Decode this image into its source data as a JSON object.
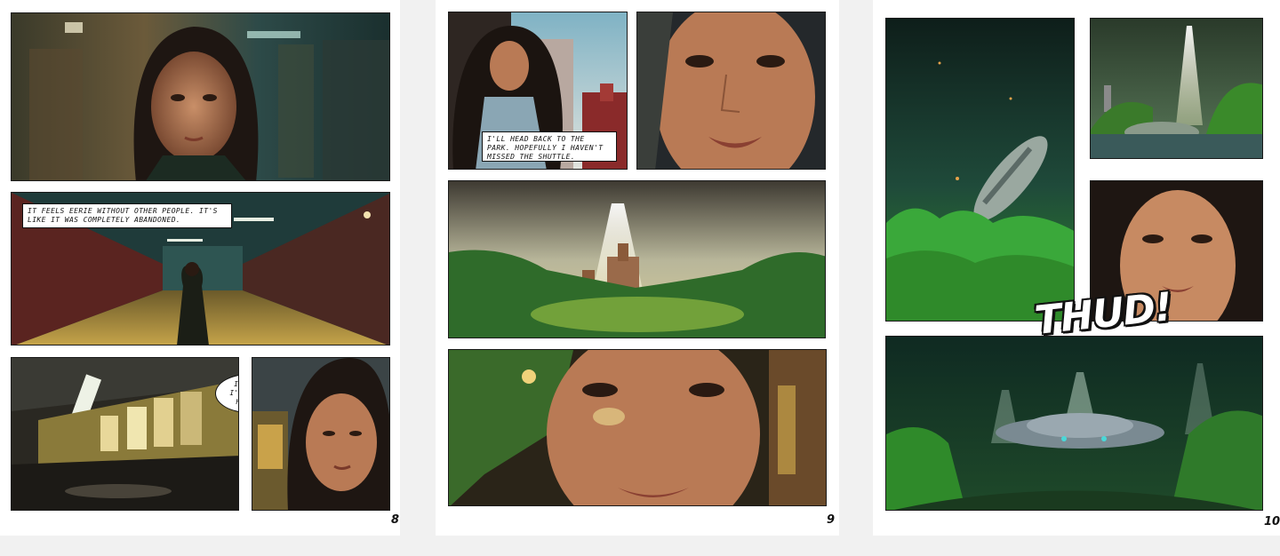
{
  "pages": [
    {
      "number": "8",
      "captions": [
        "It feels eerie without other people. It's like it was completely abandoned."
      ],
      "bubbles": [
        "I guess I'll walk home.."
      ]
    },
    {
      "number": "9",
      "captions": [
        "I'll head back to the park. Hopefully I haven't missed the shuttle."
      ]
    },
    {
      "number": "10",
      "sfx": "THUD!"
    }
  ],
  "colors": {
    "subway_teal": "#1f3b3a",
    "subway_red": "#5a2420",
    "warm_light": "#d9b46a",
    "forest_green": "#2f6b2a",
    "sky_haze": "#b8b69a",
    "skin": "#b97a55"
  }
}
